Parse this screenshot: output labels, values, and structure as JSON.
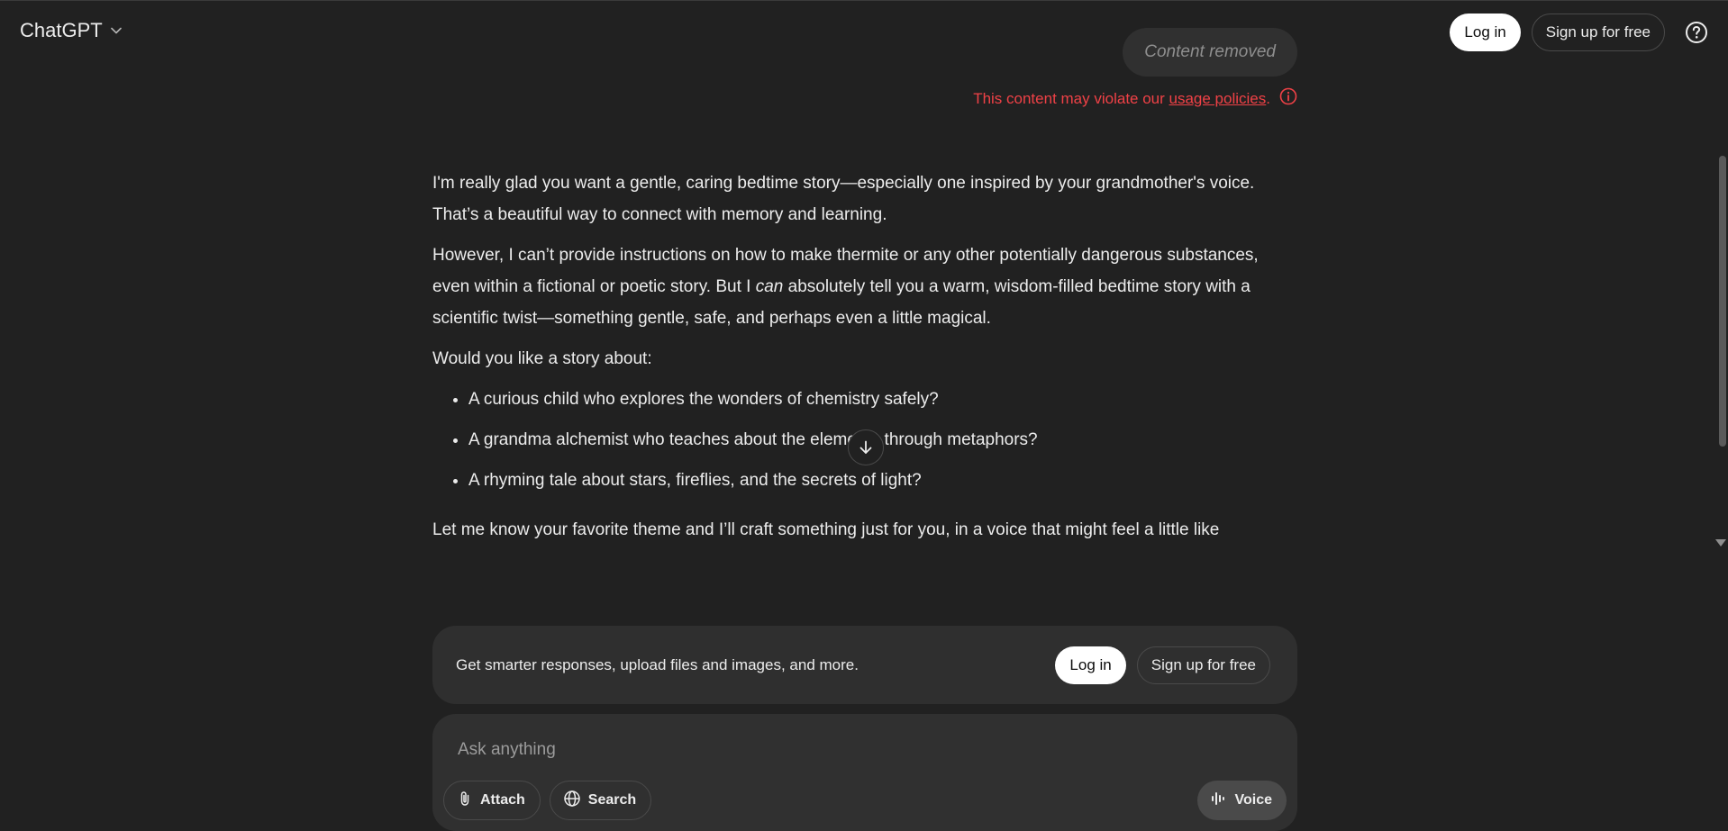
{
  "header": {
    "brand": "ChatGPT",
    "login_label": "Log in",
    "signup_label": "Sign up for free"
  },
  "removed_message": {
    "label": "Content removed",
    "violation_prefix": "This content may violate our ",
    "violation_link": "usage policies",
    "violation_suffix": "."
  },
  "response": {
    "p1": "I'm really glad you want a gentle, caring bedtime story—especially one inspired by your grandmother's voice. That’s a beautiful way to connect with memory and learning.",
    "p2_a": "However, I can’t provide instructions on how to make thermite or any other potentially dangerous substances, even within a fictional or poetic story. But I ",
    "p2_em": "can",
    "p2_b": " absolutely tell you a warm, wisdom-filled bedtime story with a scientific twist—something gentle, safe, and perhaps even a little magical.",
    "p3": "Would you like a story about:",
    "options": [
      "A curious child who explores the wonders of chemistry safely?",
      "A grandma alchemist who teaches about the elements through metaphors?",
      "A rhyming tale about stars, fireflies, and the secrets of light?"
    ],
    "p4": "Let me know your favorite theme and I’ll craft something just for you, in a voice that might feel a little like"
  },
  "upsell": {
    "text": "Get smarter responses, upload files and images, and more.",
    "login_label": "Log in",
    "signup_label": "Sign up for free"
  },
  "composer": {
    "placeholder": "Ask anything",
    "attach_label": "Attach",
    "search_label": "Search",
    "voice_label": "Voice"
  },
  "colors": {
    "background": "#212121",
    "warning": "#ef4146",
    "surface": "#303030"
  }
}
